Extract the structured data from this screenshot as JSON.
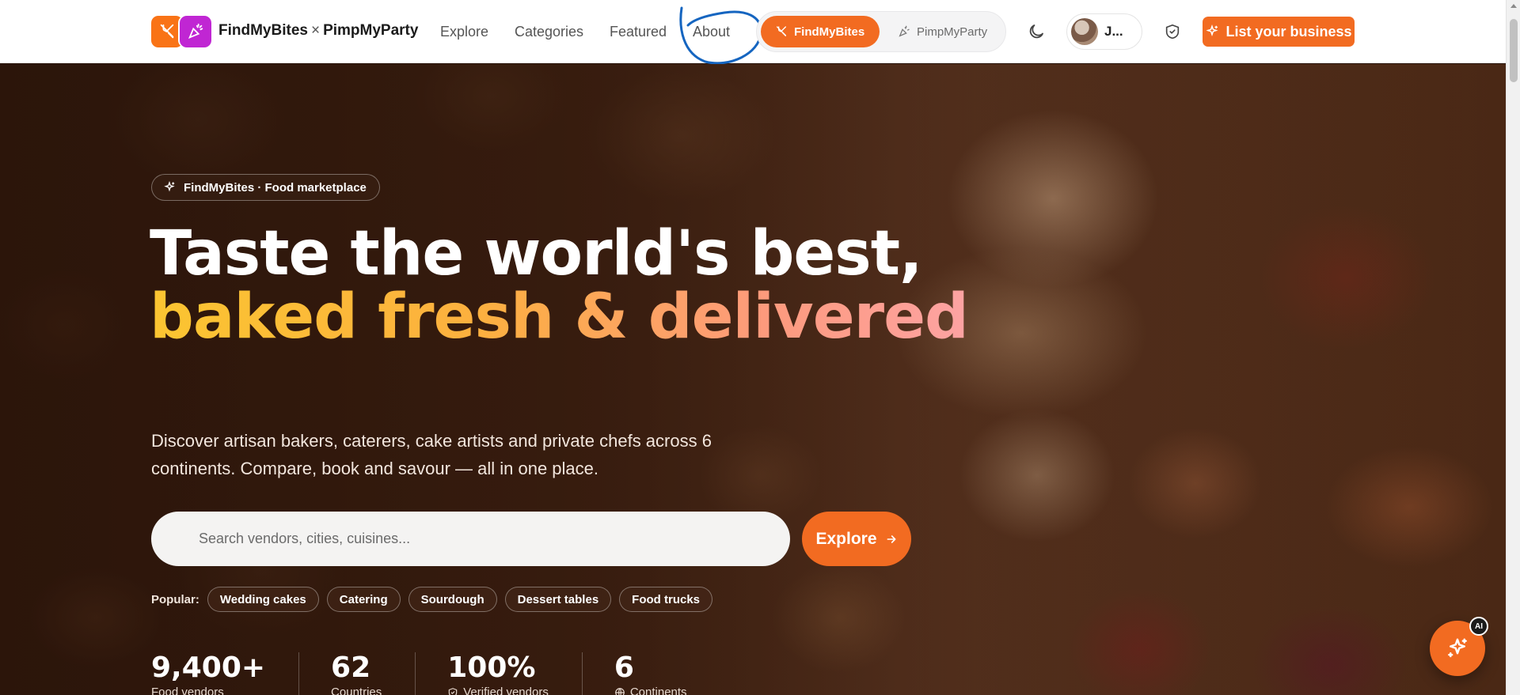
{
  "header": {
    "brand_primary": "FindMyBites",
    "brand_sep": "×",
    "brand_secondary": "PimpMyParty",
    "nav": [
      "Explore",
      "Categories",
      "Featured",
      "About"
    ],
    "toggle": {
      "active": "FindMyBites",
      "inactive": "PimpMyParty"
    },
    "user_name": "J...",
    "cta": "List your business",
    "icons": {
      "theme": "moon-icon",
      "admin": "shield-check-icon",
      "brand1": "utensils-icon",
      "brand2": "party-popper-icon"
    }
  },
  "hero": {
    "badge": "FindMyBites · Food marketplace",
    "headline_line1": "Taste the world's best,",
    "headline_line2": "baked fresh & delivered",
    "subtitle": "Discover artisan bakers, caterers, cake artists and private chefs across 6 continents. Compare, book and savour — all in one place.",
    "search_placeholder": "Search vendors, cities, cuisines...",
    "explore_label": "Explore",
    "popular_label": "Popular:",
    "popular_tags": [
      "Wedding cakes",
      "Catering",
      "Sourdough",
      "Dessert tables",
      "Food trucks"
    ],
    "stats": [
      {
        "value": "9,400+",
        "label": "Food vendors"
      },
      {
        "value": "62",
        "label": "Countries"
      },
      {
        "value": "100%",
        "label": "Verified vendors"
      },
      {
        "value": "6",
        "label": "Continents"
      }
    ]
  },
  "ai_fab": {
    "badge": "AI",
    "icon": "sparkles-icon"
  },
  "colors": {
    "accent": "#f26b21",
    "brand_purple": "#c026d3",
    "annotation_blue": "#1565c0"
  }
}
